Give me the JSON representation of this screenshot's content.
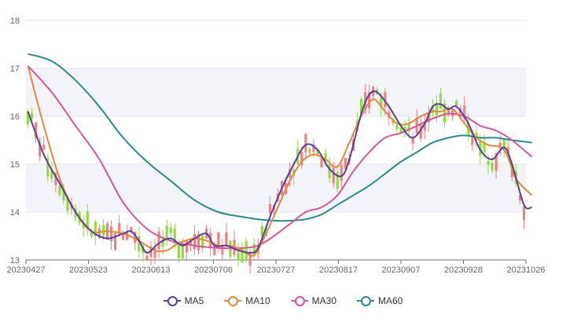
{
  "chart_data": {
    "type": "candlestick",
    "y_axis": {
      "min": 13,
      "max": 18,
      "ticks": [
        "13",
        "14",
        "15",
        "16",
        "17",
        "18"
      ]
    },
    "x_axis": {
      "ticks": [
        "20230427",
        "20230523",
        "20230613",
        "20230706",
        "20230727",
        "20230817",
        "20230907",
        "20230928",
        "20231026"
      ]
    },
    "grid": true,
    "legend_position": "bottom-center",
    "legend": [
      {
        "name": "MA5",
        "color": "#5b3f9e"
      },
      {
        "name": "MA10",
        "color": "#e08a3c"
      },
      {
        "name": "MA30",
        "color": "#d9559b"
      },
      {
        "name": "MA60",
        "color": "#2a8a8f"
      }
    ],
    "colors": {
      "up": "#f07f7f",
      "down": "#8fdc3c"
    },
    "session_count": 126,
    "moving_averages": {
      "MA5": [
        [
          0,
          16.1
        ],
        [
          4,
          15.2
        ],
        [
          8,
          14.6
        ],
        [
          12,
          14.0
        ],
        [
          16,
          13.6
        ],
        [
          20,
          13.45
        ],
        [
          24,
          13.55
        ],
        [
          26,
          13.6
        ],
        [
          28,
          13.4
        ],
        [
          30,
          13.15
        ],
        [
          33,
          13.35
        ],
        [
          36,
          13.45
        ],
        [
          39,
          13.3
        ],
        [
          42,
          13.45
        ],
        [
          45,
          13.55
        ],
        [
          47,
          13.3
        ],
        [
          50,
          13.3
        ],
        [
          53,
          13.2
        ],
        [
          56,
          13.15
        ],
        [
          58,
          13.25
        ],
        [
          61,
          13.9
        ],
        [
          64,
          14.5
        ],
        [
          67,
          15.0
        ],
        [
          70,
          15.4
        ],
        [
          73,
          15.3
        ],
        [
          76,
          14.9
        ],
        [
          79,
          14.75
        ],
        [
          81,
          15.1
        ],
        [
          84,
          16.05
        ],
        [
          86,
          16.45
        ],
        [
          88,
          16.5
        ],
        [
          91,
          16.2
        ],
        [
          94,
          15.8
        ],
        [
          97,
          15.55
        ],
        [
          100,
          15.85
        ],
        [
          102,
          16.2
        ],
        [
          104,
          16.25
        ],
        [
          106,
          16.15
        ],
        [
          108,
          16.2
        ],
        [
          111,
          15.85
        ],
        [
          114,
          15.3
        ],
        [
          117,
          15.1
        ],
        [
          120,
          15.35
        ],
        [
          122,
          15.0
        ],
        [
          125,
          14.15
        ],
        [
          127,
          14.1
        ]
      ],
      "MA10": [
        [
          0,
          17.05
        ],
        [
          4,
          15.8
        ],
        [
          8,
          14.7
        ],
        [
          12,
          14.0
        ],
        [
          16,
          13.6
        ],
        [
          20,
          13.6
        ],
        [
          24,
          13.55
        ],
        [
          28,
          13.4
        ],
        [
          32,
          13.2
        ],
        [
          35,
          13.2
        ],
        [
          38,
          13.35
        ],
        [
          42,
          13.45
        ],
        [
          45,
          13.4
        ],
        [
          48,
          13.3
        ],
        [
          51,
          13.3
        ],
        [
          54,
          13.2
        ],
        [
          57,
          13.1
        ],
        [
          60,
          13.55
        ],
        [
          63,
          14.1
        ],
        [
          66,
          14.65
        ],
        [
          69,
          15.05
        ],
        [
          72,
          15.2
        ],
        [
          75,
          15.1
        ],
        [
          78,
          14.95
        ],
        [
          81,
          15.45
        ],
        [
          84,
          16.0
        ],
        [
          87,
          16.35
        ],
        [
          90,
          16.1
        ],
        [
          93,
          15.85
        ],
        [
          96,
          15.85
        ],
        [
          99,
          16.0
        ],
        [
          102,
          16.1
        ],
        [
          104,
          16.1
        ],
        [
          107,
          16.15
        ],
        [
          110,
          15.85
        ],
        [
          113,
          15.55
        ],
        [
          116,
          15.4
        ],
        [
          120,
          15.3
        ],
        [
          123,
          14.7
        ],
        [
          127,
          14.35
        ]
      ],
      "MA30": [
        [
          0,
          17.05
        ],
        [
          6,
          16.5
        ],
        [
          12,
          15.8
        ],
        [
          18,
          15.1
        ],
        [
          24,
          14.2
        ],
        [
          30,
          13.65
        ],
        [
          36,
          13.4
        ],
        [
          42,
          13.3
        ],
        [
          48,
          13.25
        ],
        [
          54,
          13.25
        ],
        [
          58,
          13.3
        ],
        [
          62,
          13.5
        ],
        [
          66,
          13.75
        ],
        [
          70,
          14.0
        ],
        [
          74,
          14.1
        ],
        [
          78,
          14.35
        ],
        [
          82,
          14.85
        ],
        [
          86,
          15.25
        ],
        [
          90,
          15.55
        ],
        [
          94,
          15.65
        ],
        [
          98,
          15.8
        ],
        [
          102,
          15.95
        ],
        [
          106,
          16.05
        ],
        [
          110,
          16.0
        ],
        [
          114,
          15.8
        ],
        [
          118,
          15.7
        ],
        [
          122,
          15.5
        ],
        [
          127,
          15.15
        ]
      ],
      "MA60": [
        [
          0,
          17.3
        ],
        [
          6,
          17.15
        ],
        [
          12,
          16.75
        ],
        [
          18,
          16.2
        ],
        [
          24,
          15.55
        ],
        [
          30,
          15.05
        ],
        [
          36,
          14.65
        ],
        [
          42,
          14.25
        ],
        [
          48,
          14.0
        ],
        [
          54,
          13.9
        ],
        [
          58,
          13.85
        ],
        [
          62,
          13.82
        ],
        [
          66,
          13.82
        ],
        [
          70,
          13.85
        ],
        [
          74,
          13.95
        ],
        [
          78,
          14.15
        ],
        [
          82,
          14.35
        ],
        [
          86,
          14.55
        ],
        [
          90,
          14.8
        ],
        [
          94,
          15.05
        ],
        [
          98,
          15.25
        ],
        [
          102,
          15.45
        ],
        [
          106,
          15.55
        ],
        [
          110,
          15.6
        ],
        [
          114,
          15.55
        ],
        [
          118,
          15.55
        ],
        [
          122,
          15.5
        ],
        [
          127,
          15.45
        ]
      ]
    }
  }
}
